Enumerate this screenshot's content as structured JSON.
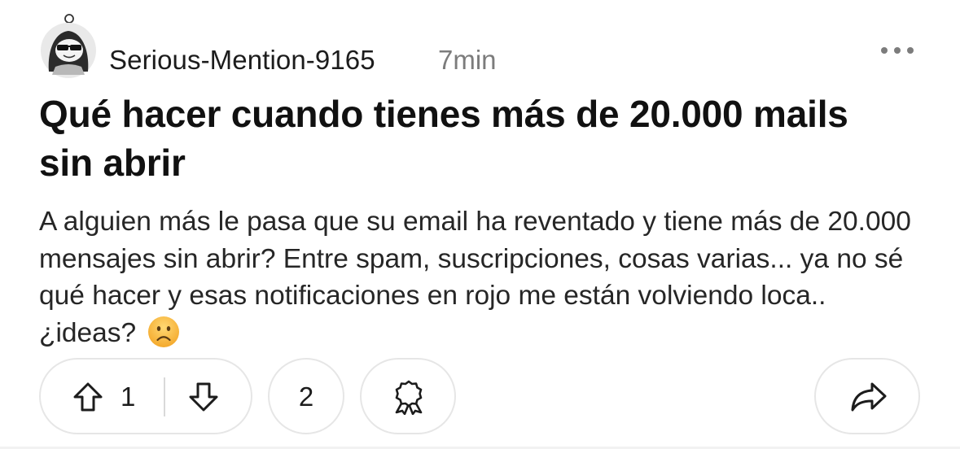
{
  "post": {
    "author": "Serious-Mention-9165",
    "time": "7min",
    "title": "Qué hacer cuando tienes más de 20.000 mails sin abrir",
    "body": "A alguien más le pasa que su email ha reventado y tiene más de 20.000 mensajes sin abrir? Entre spam, suscripciones, cosas varias... ya no sé qué hacer y esas notificaciones en rojo me están volviendo loca.. ¿ideas?",
    "emoji": "frowning-face-emoji"
  },
  "actions": {
    "upvote_icon": "arrow-up-outline-icon",
    "vote_count": "1",
    "downvote_icon": "arrow-down-outline-icon",
    "comment_count": "2",
    "award_icon": "award-ribbon-icon",
    "share_icon": "share-arrow-icon"
  },
  "header": {
    "avatar_icon": "snoo-avatar-with-sunglasses",
    "more_icon": "more-horizontal-icon"
  },
  "colors": {
    "text": "#1c1c1c",
    "muted": "#7c7c7c",
    "border": "#e6e6e6",
    "emoji_face": "#f5b43a"
  }
}
